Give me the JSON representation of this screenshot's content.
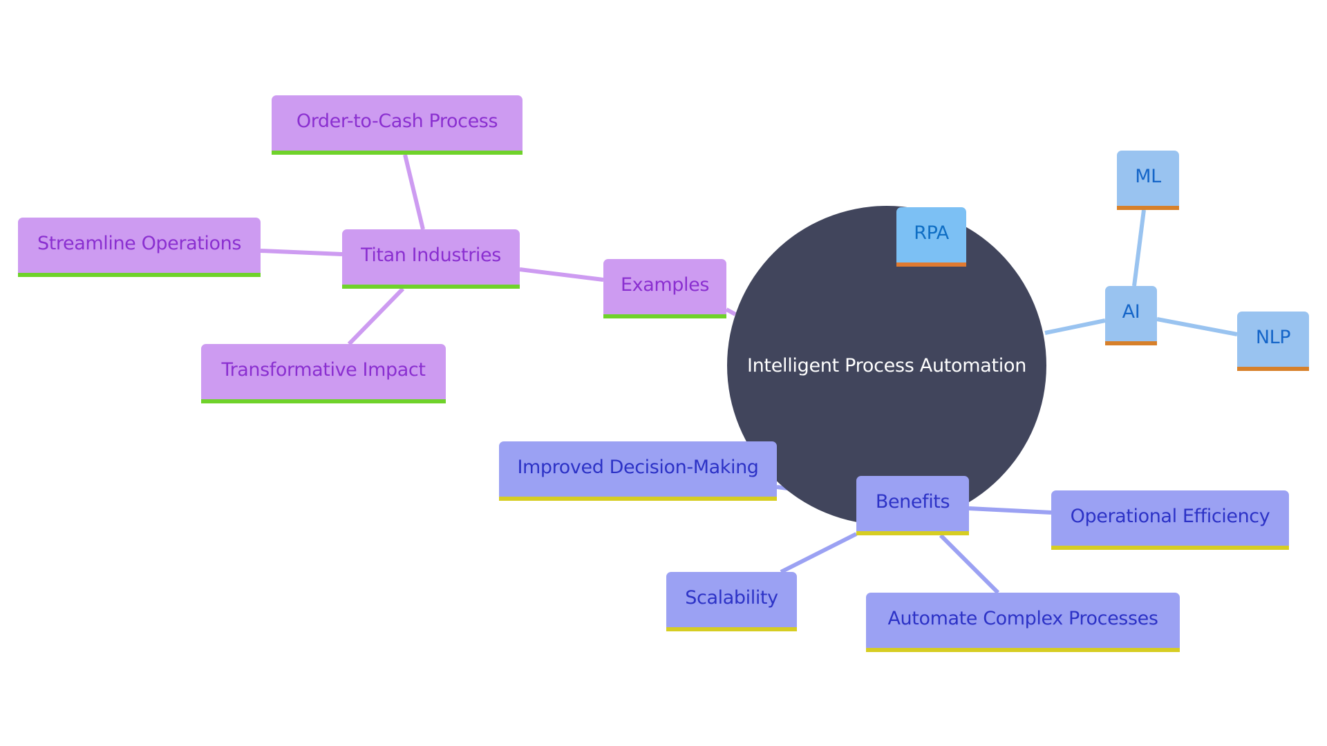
{
  "diagram": {
    "type": "mindmap",
    "root": {
      "label": "Intelligent Process Automation",
      "color": "#41455c"
    },
    "branches": {
      "examples": {
        "label": "Examples",
        "colors": {
          "fill": "#cd9bf1",
          "text": "#8a2fd0",
          "underline": "#6fd22a",
          "edge": "#cd9bf1"
        },
        "titan": {
          "label": "Titan Industries"
        },
        "children": [
          {
            "label": "Order-to-Cash Process"
          },
          {
            "label": "Streamline Operations"
          },
          {
            "label": "Transformative Impact"
          }
        ]
      },
      "rpa": {
        "label": "RPA",
        "colors": {
          "fill": "#7cc0f4",
          "text": "#0f6ec4",
          "underline": "#e07a30"
        }
      },
      "ai": {
        "label": "AI",
        "colors": {
          "fill": "#99c3f0",
          "text": "#1565c8",
          "underline": "#d7802a",
          "edge": "#99c3f0"
        },
        "children": [
          {
            "label": "ML"
          },
          {
            "label": "NLP"
          }
        ]
      },
      "benefits": {
        "label": "Benefits",
        "colors": {
          "fill": "#9ba1f3",
          "text": "#2c32c6",
          "underline": "#d6cd22",
          "edge": "#9ba1f3"
        },
        "children": [
          {
            "label": "Improved Decision-Making"
          },
          {
            "label": "Operational Efficiency"
          },
          {
            "label": "Scalability"
          },
          {
            "label": "Automate Complex Processes"
          }
        ]
      }
    }
  }
}
